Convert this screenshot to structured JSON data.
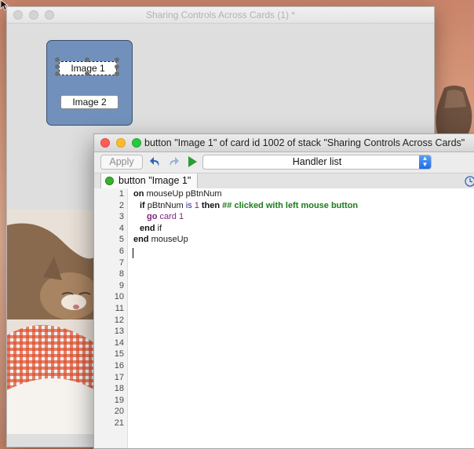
{
  "stack_window": {
    "title": "Sharing Controls Across Cards (1) *",
    "buttons": [
      {
        "label": "Image 1",
        "selected": true
      },
      {
        "label": "Image 2",
        "selected": false
      }
    ]
  },
  "editor": {
    "title": "button \"Image 1\" of card id 1002 of stack \"Sharing Controls Across Cards\"",
    "apply_label": "Apply",
    "handler_select": "Handler list",
    "tab_label": "button \"Image 1\"",
    "line_numbers": [
      "1",
      "2",
      "3",
      "4",
      "5",
      "6",
      "7",
      "8",
      "9",
      "10",
      "11",
      "12",
      "13",
      "14",
      "15",
      "16",
      "17",
      "18",
      "19",
      "20",
      "21"
    ],
    "code": {
      "line1": {
        "kw": "on",
        "rest": " mouseUp pBtnNum"
      },
      "line2": {
        "kw": "if",
        "var": " pBtnNum ",
        "op": "is",
        "num": " 1 ",
        "then": "then",
        "comment": " ## clicked with left mouse button"
      },
      "line3": {
        "go": "go",
        "card": " card ",
        "num": "1"
      },
      "line4": {
        "kw": "end",
        "rest": " if"
      },
      "line5": {
        "kw": "end",
        "rest": " mouseUp"
      }
    }
  },
  "icons": {
    "undo": "undo-icon",
    "redo": "redo-icon",
    "run": "play-icon",
    "clock": "clock-icon"
  }
}
